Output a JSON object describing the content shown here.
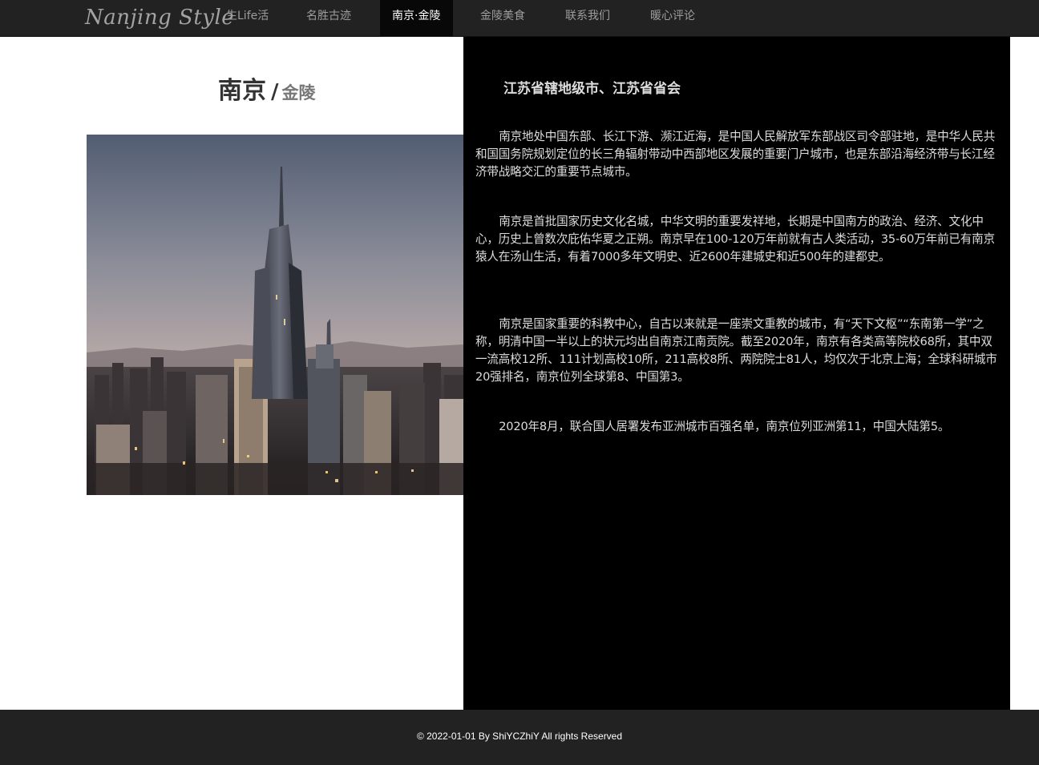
{
  "nav": {
    "brand": "Nanjing Style",
    "items": [
      {
        "label": "生Life活",
        "active": false
      },
      {
        "label": "名胜古迹",
        "active": false
      },
      {
        "label": "南京·金陵",
        "active": true
      },
      {
        "label": "金陵美食",
        "active": false
      },
      {
        "label": "联系我们",
        "active": false
      },
      {
        "label": "暖心评论",
        "active": false
      }
    ]
  },
  "hero": {
    "title_main": "南京",
    "title_sep": "/",
    "title_sub": "金陵"
  },
  "article": {
    "heading": "江苏省辖地级市、江苏省省会",
    "paragraphs": [
      "南京地处中国东部、长江下游、濒江近海，是中国人民解放军东部战区司令部驻地，是中华人民共和国国务院规划定位的长三角辐射带动中西部地区发展的重要门户城市，也是东部沿海经济带与长江经济带战略交汇的重要节点城市。",
      "南京是首批国家历史文化名城，中华文明的重要发祥地，长期是中国南方的政治、经济、文化中心，历史上曾数次庇佑华夏之正朔。南京早在100-120万年前就有古人类活动，35-60万年前已有南京猿人在汤山生活，有着7000多年文明史、近2600年建城史和近500年的建都史。",
      "南京是国家重要的科教中心，自古以来就是一座崇文重教的城市，有“天下文枢”“东南第一学”之称，明清中国一半以上的状元均出自南京江南贡院。截至2020年，南京有各类高等院校68所，其中双一流高校12所、111计划高校10所，211高校8所、两院院士81人，均仅次于北京上海；全球科研城市20强排名，南京位列全球第8、中国第3。",
      "2020年8月，联合国人居署发布亚洲城市百强名单，南京位列亚洲第11，中国大陆第5。"
    ]
  },
  "footer": {
    "copyright": "© 2022-01-01 By ShiYCZhiY All rights Reserved"
  },
  "colors": {
    "navbar_bg": "#222222",
    "nav_active_bg": "#080808",
    "nav_text": "#9d9d9d",
    "article_bg": "#000000",
    "article_text": "#dddddd"
  }
}
